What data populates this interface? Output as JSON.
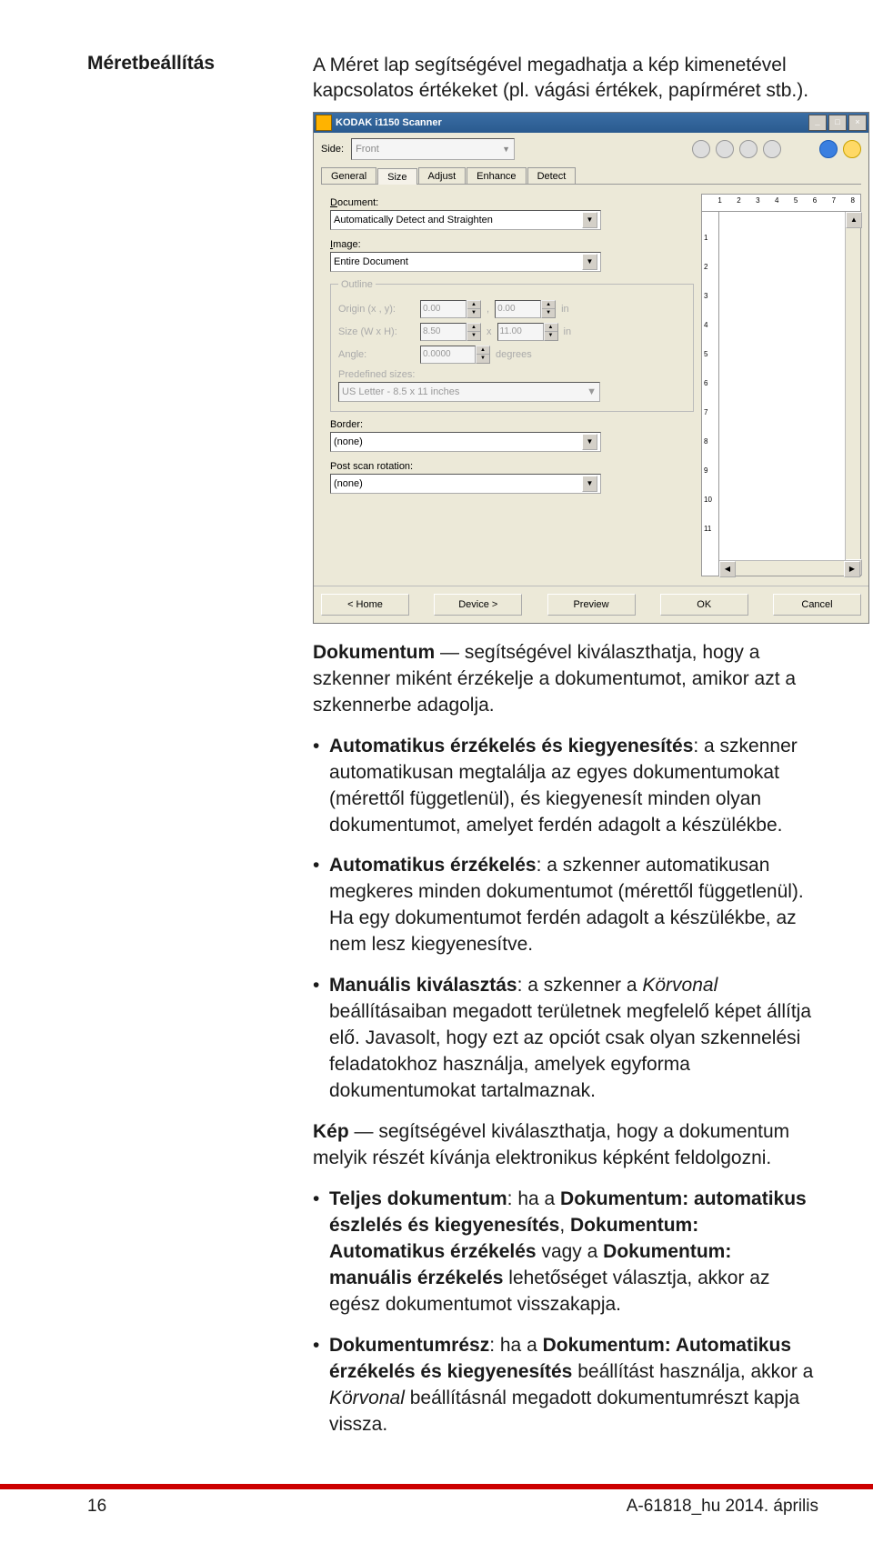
{
  "header": {
    "label": "Méretbeállítás",
    "desc": "A Méret lap segítségével megadhatja a kép kimenetével kapcsolatos értékeket (pl. vágási értékek, papírméret stb.)."
  },
  "screenshot": {
    "title": "KODAK i1150 Scanner",
    "winbtns": {
      "min": "_",
      "max": "□",
      "close": "×"
    },
    "sidebar": {
      "label": "Side:",
      "value": "Front"
    },
    "tabs": [
      "General",
      "Size",
      "Adjust",
      "Enhance",
      "Detect"
    ],
    "document": {
      "label": "Document:",
      "value": "Automatically Detect and Straighten"
    },
    "image": {
      "label": "Image:",
      "value": "Entire Document"
    },
    "outline": {
      "legend": "Outline",
      "origin": {
        "label": "Origin (x , y):",
        "x": "0.00",
        "y": "0.00",
        "unit": "in"
      },
      "size": {
        "label": "Size (W x H):",
        "w": "8.50",
        "h": "11.00",
        "unit": "in"
      },
      "angle": {
        "label": "Angle:",
        "v": "0.0000",
        "unit": "degrees"
      },
      "predef": {
        "label": "Predefined sizes:",
        "value": "US Letter - 8.5 x 11 inches"
      }
    },
    "border": {
      "label": "Border:",
      "value": "(none)"
    },
    "postscan": {
      "label": "Post scan rotation:",
      "value": "(none)"
    },
    "buttons": {
      "home": "< Home",
      "device": "Device >",
      "preview": "Preview",
      "ok": "OK",
      "cancel": "Cancel"
    },
    "ruler_h": [
      "1",
      "2",
      "3",
      "4",
      "5",
      "6",
      "7",
      "8"
    ],
    "ruler_v": [
      "1",
      "2",
      "3",
      "4",
      "5",
      "6",
      "7",
      "8",
      "9",
      "10",
      "11"
    ]
  },
  "body": {
    "p1a": "Dokumentum",
    "p1b": " — segítségével kiválaszthatja, hogy a szkenner miként érzékelje a dokumentumot, amikor azt a szkennerbe adagolja.",
    "li1a": "Automatikus érzékelés és kiegyenesítés",
    "li1b": ": a szkenner automatikusan megtalálja az egyes dokumentumokat (mérettől függetlenül), és kiegyenesít minden olyan dokumentumot, amelyet ferdén adagolt a készülékbe.",
    "li2a": "Automatikus érzékelés",
    "li2b": ": a szkenner automatikusan megkeres minden dokumentumot (mérettől függetlenül). Ha egy dokumentumot ferdén adagolt a készülékbe, az nem lesz kiegyenesítve.",
    "li3a": "Manuális kiválasztás",
    "li3b": ": a szkenner a ",
    "li3c": "Körvonal",
    "li3d": " beállításaiban megadott területnek megfelelő képet állítja elő. Javasolt, hogy ezt az opciót csak olyan szkennelési feladatokhoz használja, amelyek egyforma dokumentumokat tartalmaznak.",
    "p2a": "Kép",
    "p2b": " — segítségével kiválaszthatja, hogy a dokumentum melyik részét kívánja elektronikus képként feldolgozni.",
    "li4a": "Teljes dokumentum",
    "li4b": ": ha a ",
    "li4c": "Dokumentum: automatikus észlelés és kiegyenesítés",
    "li4d": ", ",
    "li4e": "Dokumentum: Automatikus érzékelés",
    "li4f": " vagy a ",
    "li4g": "Dokumentum: manuális érzékelés",
    "li4h": " lehetőséget választja, akkor az egész dokumentumot visszakapja.",
    "li5a": "Dokumentumrész",
    "li5b": ": ha a ",
    "li5c": "Dokumentum: Automatikus érzékelés és kiegyenesítés",
    "li5d": " beállítást használja, akkor a ",
    "li5e": "Körvonal",
    "li5f": " beállításnál megadott dokumentumrészt kapja vissza."
  },
  "footer": {
    "left": "16",
    "right": "A-61818_hu 2014. április"
  }
}
